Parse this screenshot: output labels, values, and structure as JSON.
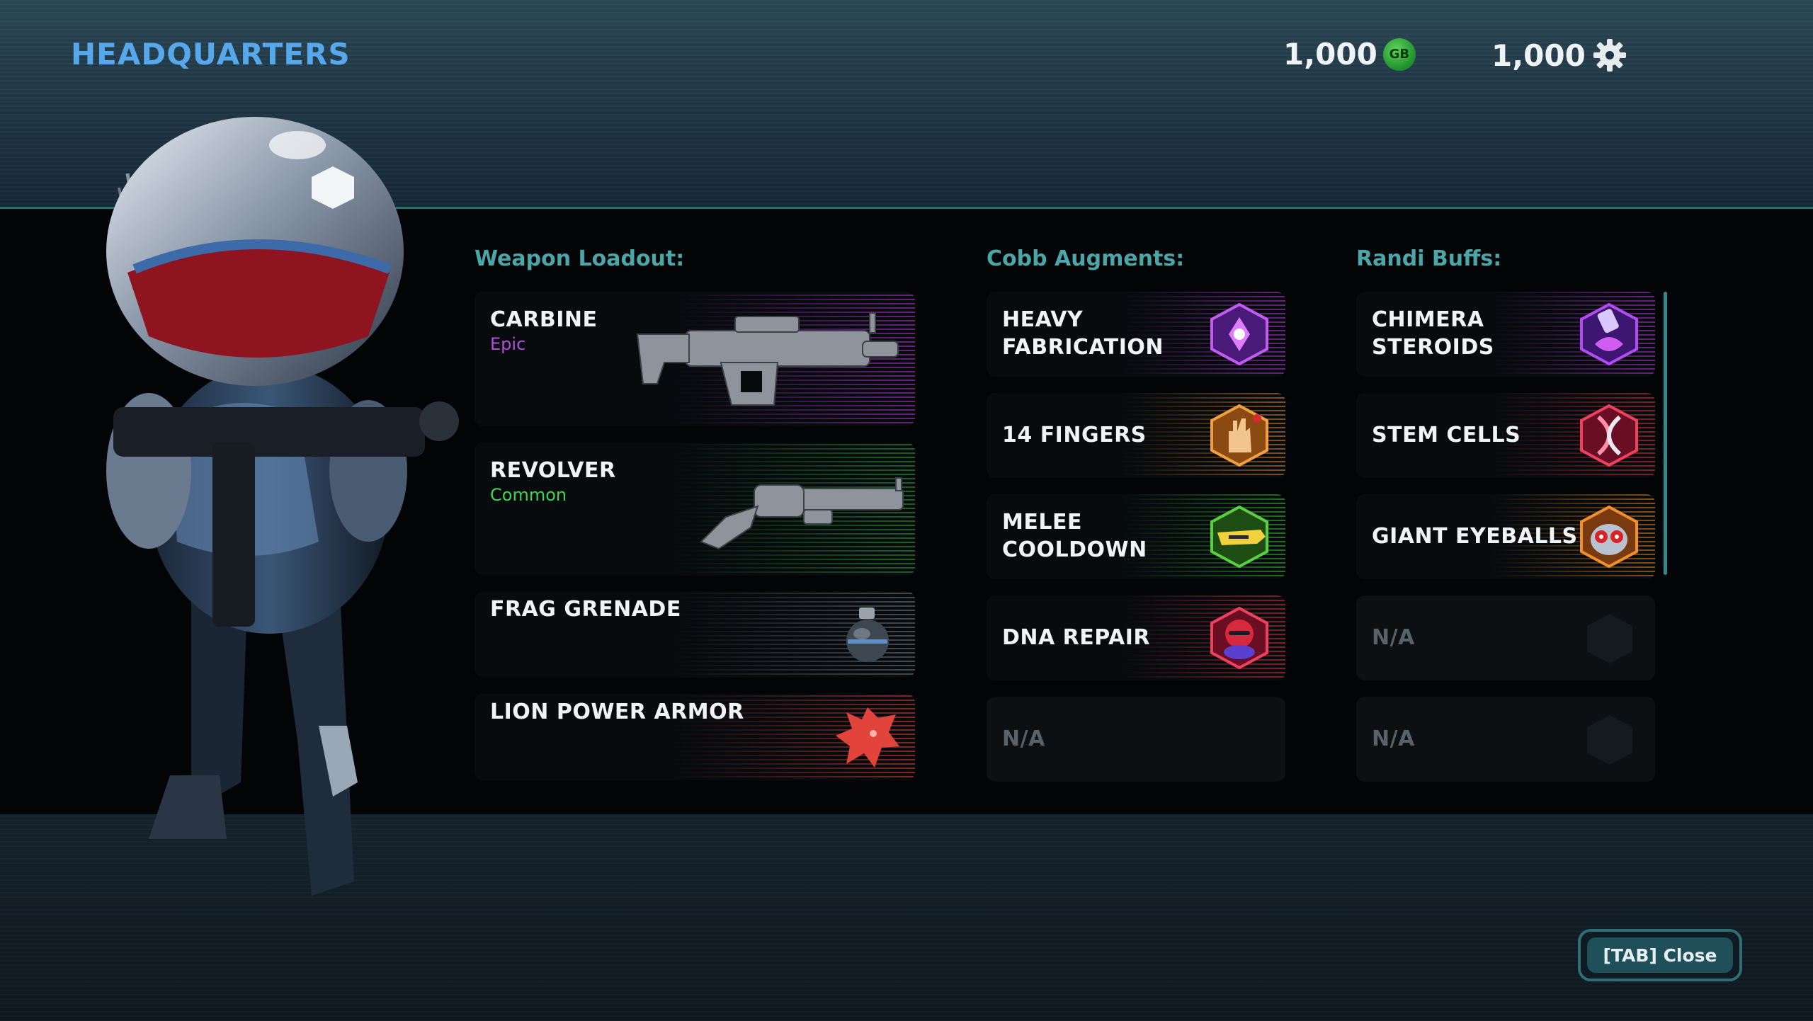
{
  "header": {
    "title": "HEADQUARTERS",
    "currency_gb": {
      "amount": "1,000",
      "icon": "gb-coin-icon",
      "icon_text": "GB"
    },
    "currency_parts": {
      "amount": "1,000",
      "icon": "gear-icon"
    }
  },
  "loadout": {
    "header": "Weapon Loadout:",
    "items": [
      {
        "name": "CARBINE",
        "rarity": "Epic",
        "rarity_color": "#b04fd6",
        "icon": "carbine-rifle-icon",
        "accent": "#b23bd2"
      },
      {
        "name": "REVOLVER",
        "rarity": "Common",
        "rarity_color": "#3bd44c",
        "icon": "revolver-icon",
        "accent": "#2aa63a"
      },
      {
        "name": "FRAG GRENADE",
        "icon": "frag-grenade-icon",
        "accent": "#7a7f86"
      },
      {
        "name": "LION POWER ARMOR",
        "icon": "lion-head-icon",
        "accent": "#e0433a"
      }
    ]
  },
  "augments": {
    "header": "Cobb Augments:",
    "items": [
      {
        "name": "HEAVY\nFABRICATION",
        "icon": "heavy-fabrication-icon",
        "accent": "#b23bd2"
      },
      {
        "name": "14 FINGERS",
        "icon": "fourteen-fingers-icon",
        "accent": "#e58a24"
      },
      {
        "name": "MELEE\nCOOLDOWN",
        "icon": "melee-cooldown-icon",
        "accent": "#3fbf3a"
      },
      {
        "name": "DNA REPAIR",
        "icon": "dna-repair-icon",
        "accent": "#e0334a"
      },
      {
        "name": "N/A",
        "empty": true
      }
    ]
  },
  "buffs": {
    "header": "Randi Buffs:",
    "items": [
      {
        "name": "CHIMERA\nSTEROIDS",
        "icon": "chimera-steroids-icon",
        "accent": "#b23bd2"
      },
      {
        "name": "STEM CELLS",
        "icon": "stem-cells-icon",
        "accent": "#e0334a"
      },
      {
        "name": "GIANT EYEBALLS",
        "icon": "giant-eyeballs-icon",
        "accent": "#e58a24"
      },
      {
        "name": "N/A",
        "empty": true
      },
      {
        "name": "N/A",
        "empty": true
      }
    ]
  },
  "footer": {
    "close_label": "[TAB] Close"
  }
}
